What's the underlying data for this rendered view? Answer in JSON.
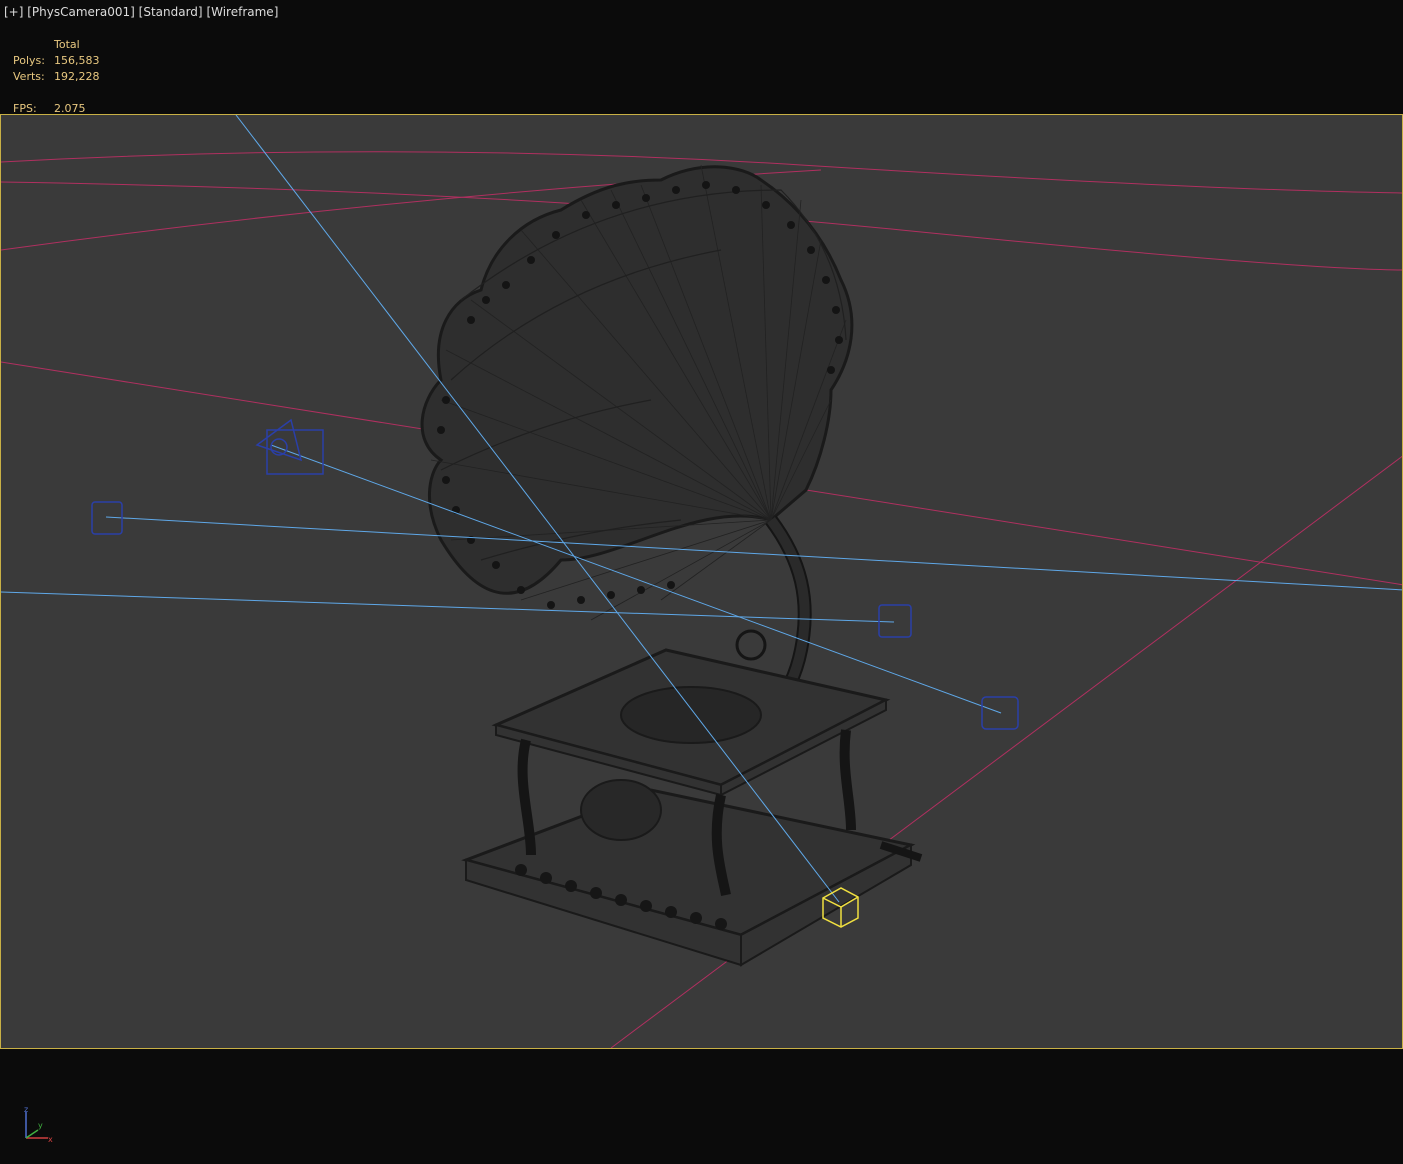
{
  "viewport": {
    "label_plus": "[+]",
    "label_camera": "[PhysCamera001]",
    "label_shading": "[Standard]",
    "label_mode": "[Wireframe]"
  },
  "stats": {
    "header": "Total",
    "polys_label": "Polys:",
    "polys_value": "156,583",
    "verts_label": "Verts:",
    "verts_value": "192,228",
    "fps_label": "FPS:",
    "fps_value": "2.075"
  },
  "gizmo": {
    "z_label": "z",
    "y_label": "y",
    "x_label": "x"
  },
  "colors": {
    "frame_border": "#c8b045",
    "viewport_bg": "#3a3a3a",
    "light_line": "#5fa8e8",
    "grid_line": "#b03060",
    "selected": "#f0e040",
    "light_icon": "#2a3fa8"
  }
}
